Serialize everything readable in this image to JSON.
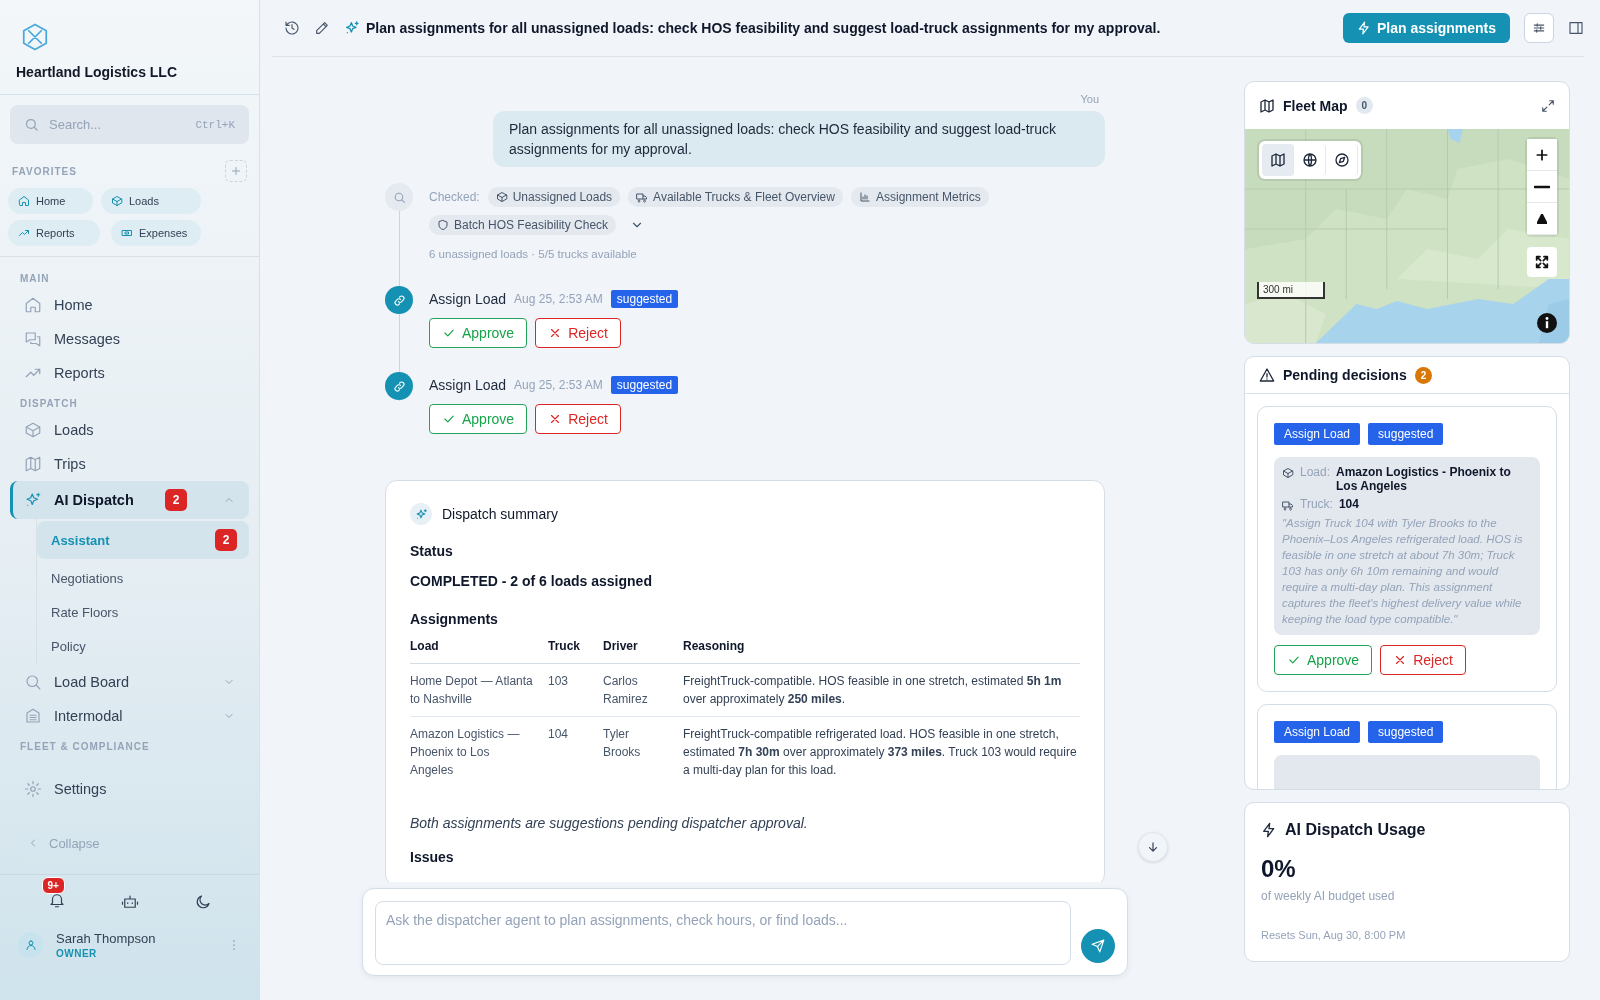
{
  "sidebar": {
    "company": "Heartland Logistics LLC",
    "search": {
      "placeholder": "Search...",
      "shortcut": "Ctrl+K"
    },
    "favorites": {
      "title": "FAVORITES",
      "items": [
        {
          "label": "Home"
        },
        {
          "label": "Loads"
        },
        {
          "label": "Reports"
        },
        {
          "label": "Expenses"
        }
      ]
    },
    "sections": [
      {
        "title": "MAIN",
        "items": [
          {
            "label": "Home",
            "selected": false
          },
          {
            "label": "Messages",
            "selected": false
          },
          {
            "label": "Reports",
            "selected": false
          }
        ]
      },
      {
        "title": "DISPATCH",
        "items": [
          {
            "label": "Loads",
            "selected": false
          },
          {
            "label": "Trips",
            "selected": false
          },
          {
            "label": "AI Dispatch",
            "selected": true,
            "badge": "2",
            "expanded": true,
            "children": [
              {
                "label": "Assistant",
                "selected": true,
                "badge": "2"
              },
              {
                "label": "Negotiations",
                "selected": false
              },
              {
                "label": "Rate Floors",
                "selected": false
              },
              {
                "label": "Policy",
                "selected": false
              }
            ]
          },
          {
            "label": "Load Board",
            "selected": false,
            "expanded": false
          },
          {
            "label": "Intermodal",
            "selected": false,
            "expanded": false
          }
        ]
      },
      {
        "title": "FLEET & COMPLIANCE",
        "items": [
          {
            "label": "Settings",
            "selected": false
          }
        ]
      }
    ],
    "collapse": "Collapse",
    "notification_badge": "9+",
    "user": {
      "name": "Sarah Thompson",
      "role": "OWNER"
    }
  },
  "topbar": {
    "title": "Plan assignments for all unassigned loads: check HOS feasibility and suggest load-truck assignments for my approval.",
    "action": "Plan assignments"
  },
  "chat": {
    "user_message": {
      "author": "You",
      "text": "Plan assignments for all unassigned loads: check HOS feasibility and suggest load-truck assignments for my approval."
    },
    "tool_step": {
      "label": "Checked:",
      "tools": [
        "Unassigned Loads",
        "Available Trucks & Fleet Overview",
        "Assignment Metrics",
        "Batch HOS Feasibility Check"
      ],
      "expanded": false,
      "summary": "6 unassigned loads · 5/5 trucks available"
    },
    "actions": [
      {
        "title": "Assign Load",
        "time": "Aug 25, 2:53 AM",
        "status": "suggested",
        "approve": "Approve",
        "reject": "Reject"
      },
      {
        "title": "Assign Load",
        "time": "Aug 25, 2:53 AM",
        "status": "suggested",
        "approve": "Approve",
        "reject": "Reject"
      }
    ],
    "summary": {
      "title": "Dispatch summary",
      "status_heading": "Status",
      "status": "COMPLETED - 2 of 6 loads assigned",
      "assignments_heading": "Assignments",
      "columns": [
        "Load",
        "Truck",
        "Driver",
        "Reasoning"
      ],
      "rows": [
        [
          "Home Depot — Atlanta to Nashville",
          "103",
          "Carlos Ramirez",
          "FreightTruck-compatible. HOS feasible in one stretch, estimated **5h 1m** over approximately **250 miles**."
        ],
        [
          "Amazon Logistics — Phoenix to Los Angeles",
          "104",
          "Tyler Brooks",
          "FreightTruck-compatible refrigerated load. HOS feasible in one stretch, estimated **7h 30m** over approximately **373 miles**. Truck 103 would require a multi-day plan for this load."
        ]
      ],
      "note": "Both assignments are suggestions pending dispatcher approval.",
      "issues_heading": "Issues"
    },
    "composer": {
      "placeholder": "Ask the dispatcher agent to plan assignments, check hours, or find loads..."
    }
  },
  "fleet_map": {
    "title": "Fleet Map",
    "count": "0",
    "scale": "300 mi"
  },
  "pending": {
    "title": "Pending decisions",
    "count": "2",
    "cards": [
      {
        "tags": [
          "Assign Load",
          "suggested"
        ],
        "load_label": "Load:",
        "load": "Amazon Logistics - Phoenix to Los Angeles",
        "truck_label": "Truck:",
        "truck": "104",
        "quote": "\"Assign Truck 104 with Tyler Brooks to the Phoenix–Los Angeles refrigerated load. HOS is feasible in one stretch at about 7h 30m; Truck 103 has only 6h 10m remaining and would require a multi-day plan. This assignment captures the fleet's highest delivery value while keeping the load type compatible.\"",
        "approve": "Approve",
        "reject": "Reject"
      },
      {
        "tags": [
          "Assign Load",
          "suggested"
        ]
      }
    ]
  },
  "usage": {
    "title": "AI Dispatch Usage",
    "value": "0%",
    "caption": "of weekly AI budget used",
    "reset": "Resets Sun, Aug 30, 8:00 PM"
  }
}
